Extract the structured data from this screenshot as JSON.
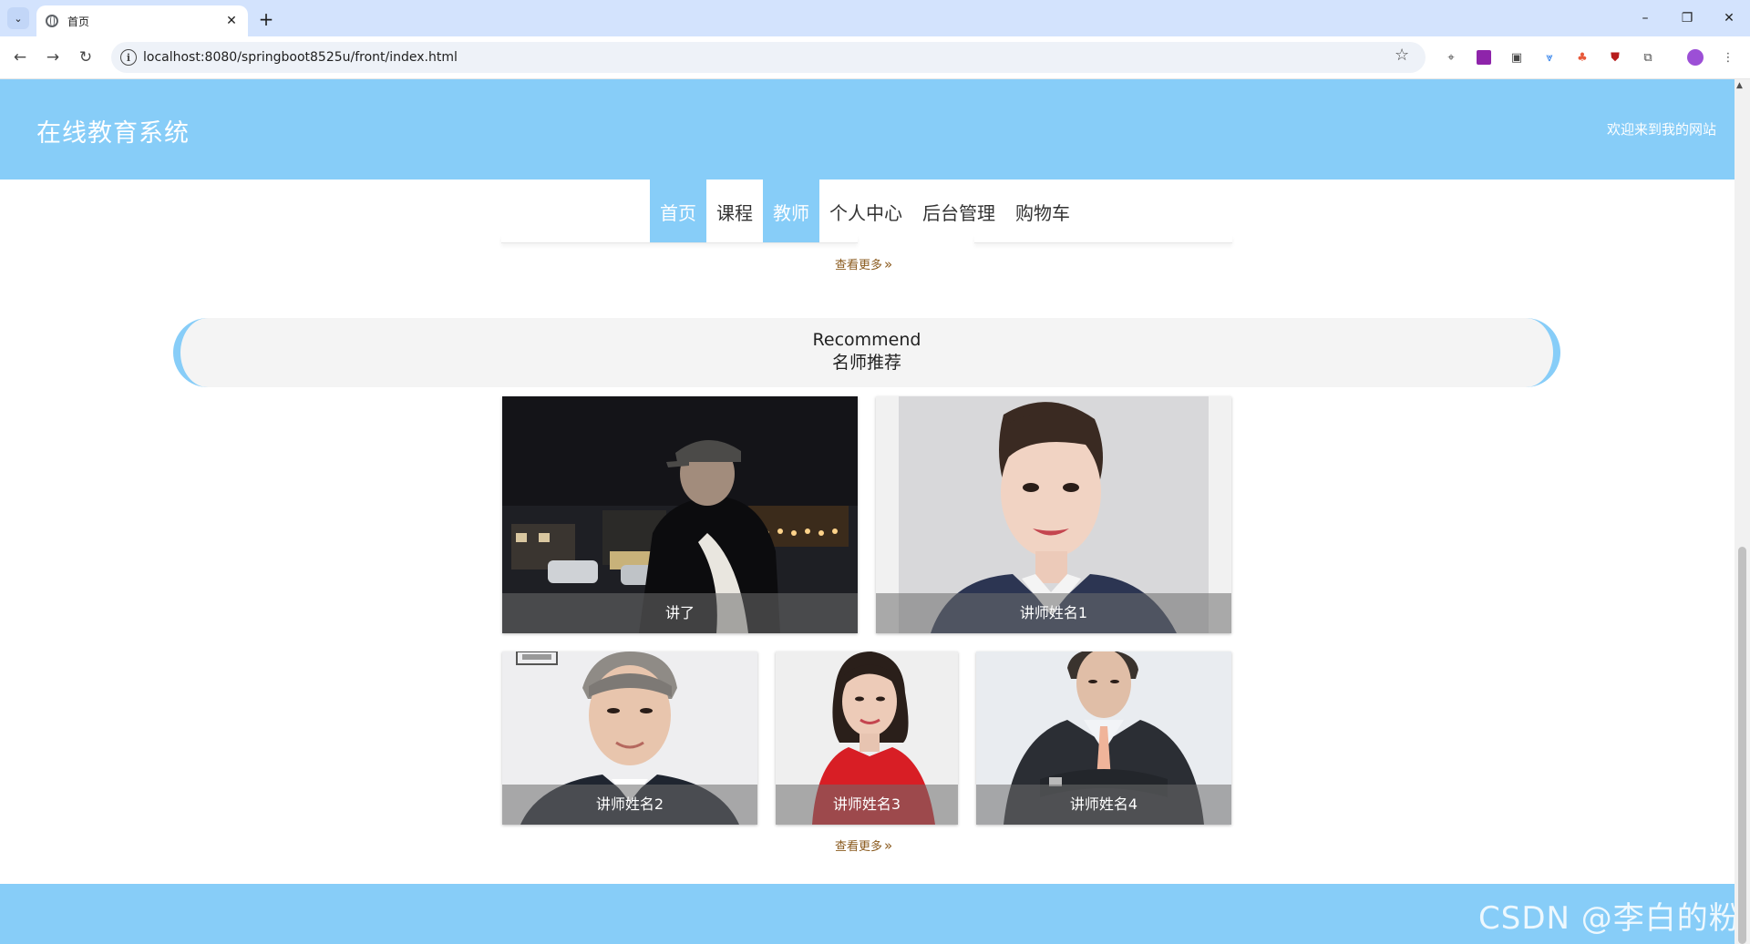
{
  "browser": {
    "tab_title": "首页",
    "tab_list_icon": "chevron-down-icon",
    "new_tab_label": "+",
    "close_tab_label": "✕",
    "url": "localhost:8080/springboot8525u/front/index.html",
    "window_controls": {
      "minimize": "–",
      "restore": "❐",
      "close": "✕"
    }
  },
  "header": {
    "site_title": "在线教育系统",
    "welcome": "欢迎来到我的网站",
    "accent_color": "#87cdf8"
  },
  "nav": {
    "items": [
      {
        "label": "首页",
        "active": true
      },
      {
        "label": "课程",
        "active": false
      },
      {
        "label": "教师",
        "active": true
      },
      {
        "label": "个人中心",
        "active": false
      },
      {
        "label": "后台管理",
        "active": false
      },
      {
        "label": "购物车",
        "active": false
      }
    ]
  },
  "course_section": {
    "more_label": "查看更多"
  },
  "teacher_section": {
    "title_en": "Recommend",
    "title_cn": "名师推荐",
    "more_label": "查看更多",
    "teachers": [
      {
        "name": "讲了"
      },
      {
        "name": "讲师姓名1"
      },
      {
        "name": "讲师姓名2"
      },
      {
        "name": "讲师姓名3"
      },
      {
        "name": "讲师姓名4"
      }
    ]
  },
  "watermark": "CSDN @李白的粉"
}
